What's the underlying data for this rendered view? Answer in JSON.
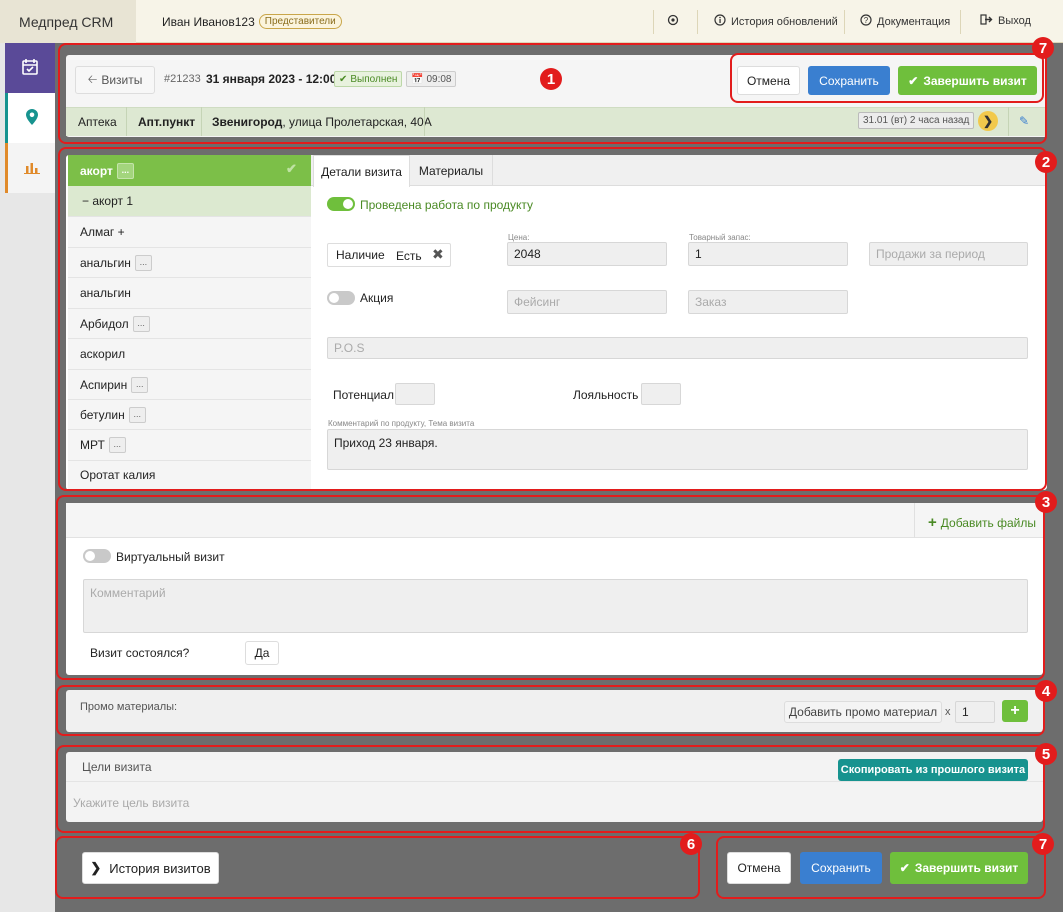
{
  "topbar": {
    "brand": "Медпред CRM",
    "user": "Иван Иванов123",
    "role": "Представители",
    "history": "История обновлений",
    "docs": "Документация",
    "logout": "Выход"
  },
  "visit": {
    "back_label": "Визиты",
    "id": "#21233",
    "datetime": "31 января 2023 - 12:00",
    "status": "Выполнен",
    "time": "09:08",
    "cancel": "Отмена",
    "save": "Сохранить",
    "complete": "Завершить визит",
    "place_type": "Аптека",
    "place_name": "Апт.пункт",
    "city": "Звенигород",
    "address": ", улица Пролетарская, 40А",
    "last_visit": "31.01 (вт) 2 часа назад"
  },
  "products": {
    "items": [
      {
        "label": "акорт",
        "dots": "..."
      },
      {
        "label": "− акорт 1"
      },
      {
        "label": "Алмаг +"
      },
      {
        "label": "анальгин",
        "dots": "..."
      },
      {
        "label": "анальгин"
      },
      {
        "label": "Арбидол",
        "dots": "..."
      },
      {
        "label": "аскорил"
      },
      {
        "label": "Аспирин",
        "dots": "..."
      },
      {
        "label": "бетулин",
        "dots": "..."
      },
      {
        "label": "МРТ",
        "dots": "..."
      },
      {
        "label": "Оротат калия"
      }
    ]
  },
  "details": {
    "tab_details": "Детали визита",
    "tab_materials": "Материалы",
    "product_work": "Проведена работа по продукту",
    "availability_label": "Наличие",
    "availability_value": "Есть",
    "price_label": "Цена:",
    "price": "2048",
    "stock_label": "Товарный запас:",
    "stock": "1",
    "sales_ph": "Продажи за период",
    "promo_label": "Акция",
    "facing_ph": "Фейсинг",
    "order_ph": "Заказ",
    "pos_ph": "P.O.S",
    "potential_label": "Потенциал",
    "loyalty_label": "Лояльность",
    "comment_label": "Комментарий по продукту, Тема визита",
    "comment": "Приход 23 января."
  },
  "section3": {
    "add_files": "Добавить файлы",
    "virtual_visit": "Виртуальный визит",
    "comment_ph": "Комментарий",
    "took_place": "Визит состоялся?",
    "yes": "Да"
  },
  "promo": {
    "label": "Промо материалы:",
    "add": "Добавить промо материал",
    "x": "x",
    "qty": "1"
  },
  "goals": {
    "title": "Цели визита",
    "copy": "Скопировать из прошлого визита",
    "placeholder": "Укажите цель визита"
  },
  "footer": {
    "history": "История визитов",
    "cancel": "Отмена",
    "save": "Сохранить",
    "complete": "Завершить визит"
  },
  "badges": [
    "1",
    "2",
    "3",
    "4",
    "5",
    "6",
    "7",
    "7"
  ],
  "colors": {
    "green": "#6fbf3c",
    "blue": "#3a7fd0",
    "teal": "#17938f",
    "annotation_red": "#e21c1c"
  }
}
